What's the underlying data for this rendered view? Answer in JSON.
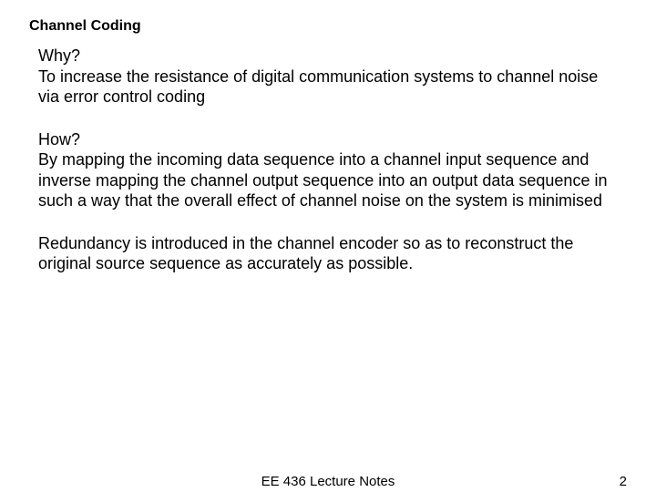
{
  "title": "Channel Coding",
  "why_q": "Why?",
  "why_a": "To increase the resistance of digital communication systems to channel noise via error control coding",
  "how_q": "How?",
  "how_a": "By mapping the incoming data sequence into a channel input sequence and inverse mapping the channel output sequence into an output data sequence in such a way that the overall effect of channel noise on the system is minimised",
  "redundancy": "Redundancy is introduced in the channel encoder so as to reconstruct the original source sequence as accurately as possible.",
  "footer_center": "EE 436 Lecture Notes",
  "footer_right": "2"
}
